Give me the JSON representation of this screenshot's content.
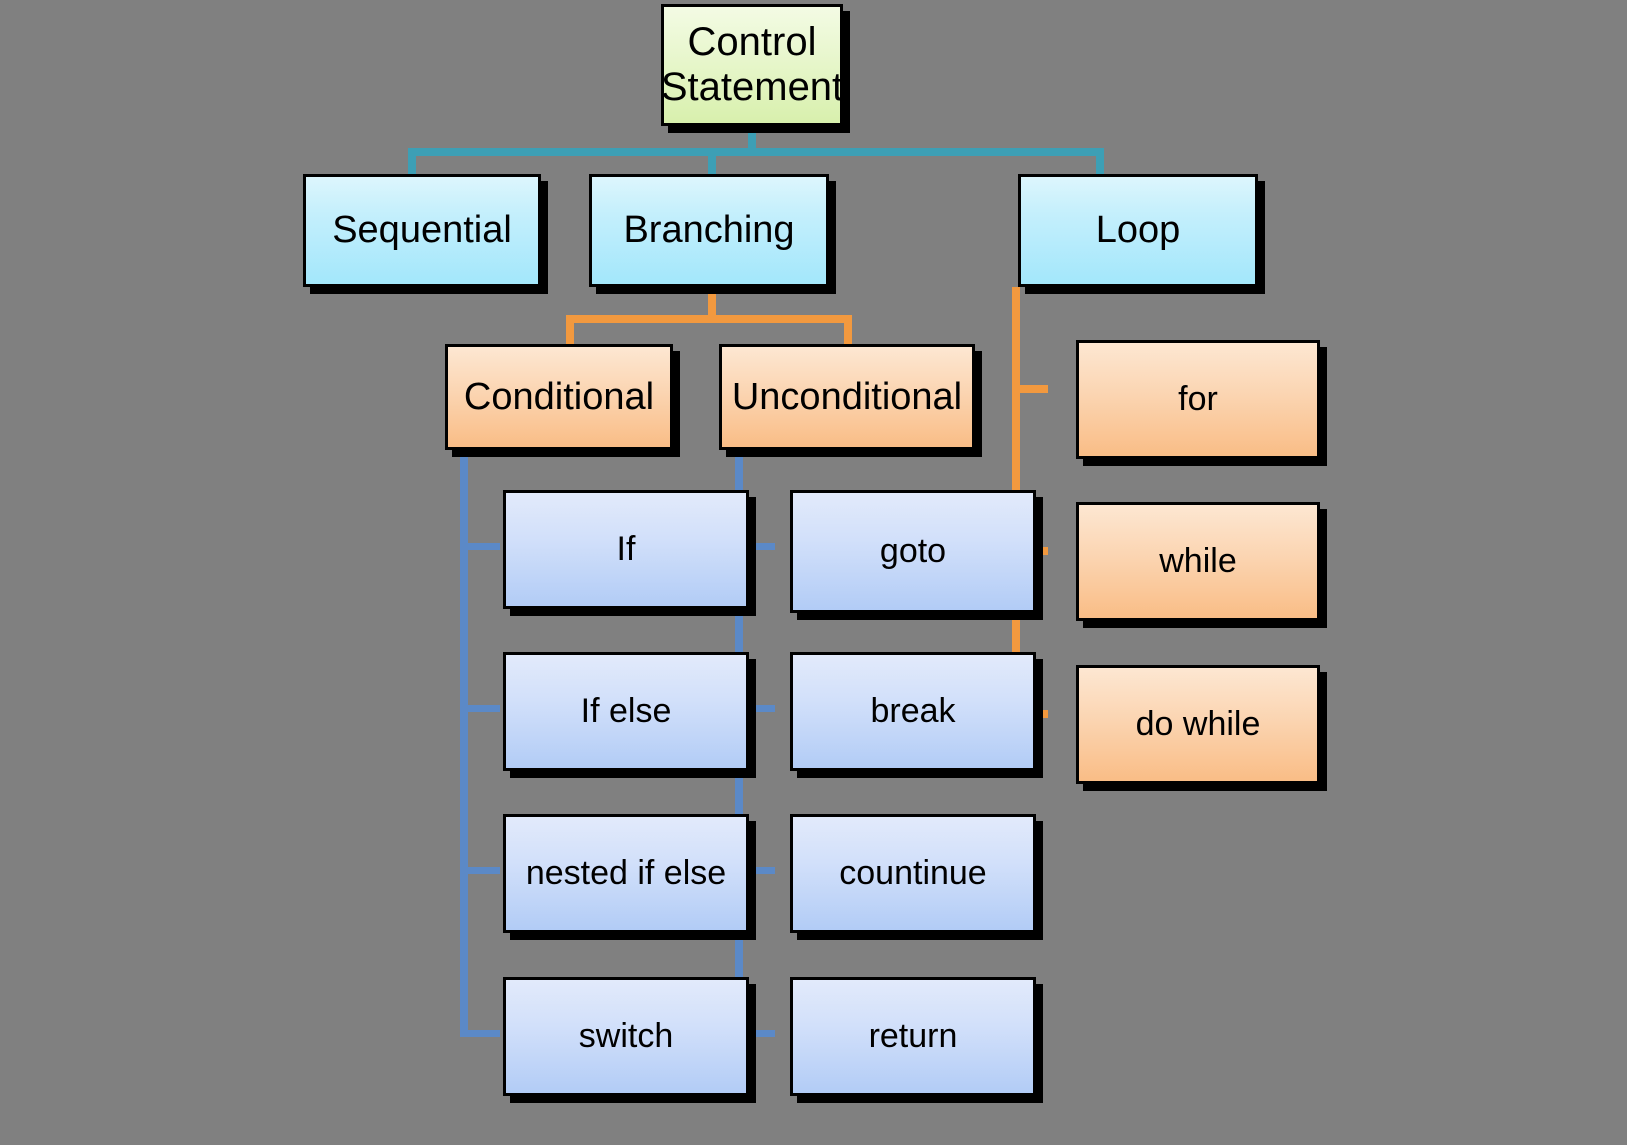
{
  "diagram": {
    "title": "Control Statement",
    "background_color": "#808080",
    "colors": {
      "root_fill": "#d8f0ad",
      "level2_fill": "#a3e7fb",
      "branch_fill": "#f9bd86",
      "leaf_fill": "#b2ccf6",
      "teal_connector": "#3d9fb5",
      "orange_connector": "#f2993f",
      "blue_connector": "#5b89c7",
      "border": "#000000"
    },
    "root": {
      "label": "Control Statement"
    },
    "level2": [
      {
        "label": "Sequential"
      },
      {
        "label": "Branching"
      },
      {
        "label": "Loop"
      }
    ],
    "branching_children": [
      {
        "label": "Conditional"
      },
      {
        "label": "Unconditional"
      }
    ],
    "conditional_children": [
      {
        "label": "If"
      },
      {
        "label": "If else"
      },
      {
        "label": "nested if else"
      },
      {
        "label": "switch"
      }
    ],
    "unconditional_children": [
      {
        "label": "goto"
      },
      {
        "label": "break"
      },
      {
        "label": "countinue"
      },
      {
        "label": "return"
      }
    ],
    "loop_children": [
      {
        "label": "for"
      },
      {
        "label": "while"
      },
      {
        "label": "do while"
      }
    ]
  }
}
